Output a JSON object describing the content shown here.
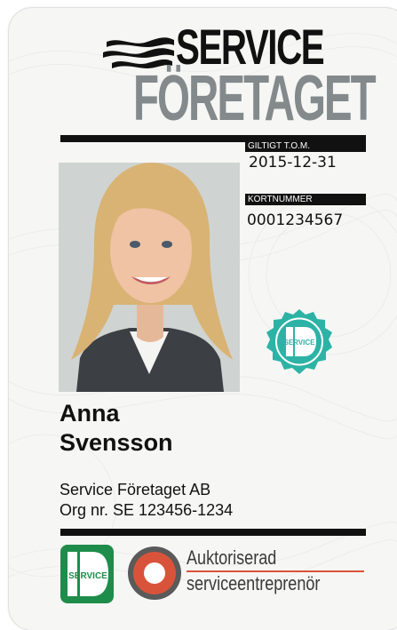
{
  "card": {
    "logo": {
      "line1": "SERVICE",
      "line2": "FÖRETAGET"
    },
    "valid_until": {
      "label": "GILTIGT T.O.M.",
      "value": "2015-12-31"
    },
    "card_number": {
      "label": "KORTNUMMER",
      "value": "0001234567"
    },
    "holder": {
      "first_name": "Anna",
      "last_name": "Svensson"
    },
    "company": {
      "name": "Service Företaget AB",
      "org_nr": "Org nr. SE 123456-1234"
    },
    "seal": {
      "text": "SERVICE",
      "color": "#2db3a6"
    },
    "id_badge": {
      "text": "SERVICE",
      "color": "#1e8c4b"
    },
    "authorized": {
      "line1": "Auktoriserad",
      "line2": "serviceentreprenör",
      "ring_color": "#d9533a"
    }
  }
}
